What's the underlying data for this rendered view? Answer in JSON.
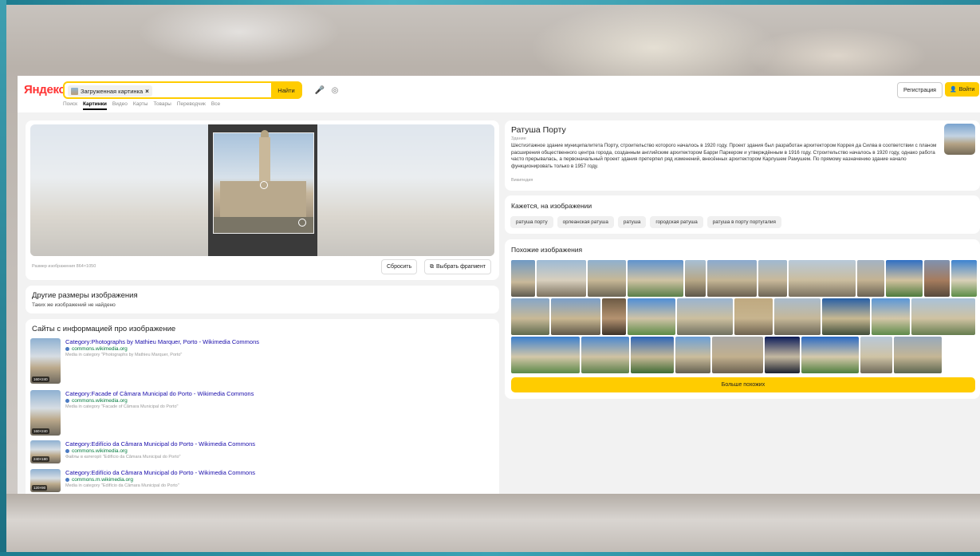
{
  "header": {
    "logo": "Яндекс",
    "search_chip_label": "Загруженная картинка",
    "search_chip_close": "×",
    "find_label": "Найти",
    "tabs": [
      "Поиск",
      "Картинки",
      "Видео",
      "Карты",
      "Товары",
      "Переводчик",
      "Все"
    ],
    "register_label": "Регистрация",
    "login_label": "Войти"
  },
  "preview": {
    "size_text": "Размер изображения 864×1050",
    "reset_label": "Сбросить",
    "crop_label": "Выбрать фрагмент"
  },
  "sizes": {
    "title": "Другие размеры изображения",
    "subtitle": "Таких же изображений не найдено"
  },
  "sites": {
    "title": "Сайты с информацией про изображение",
    "items": [
      {
        "title": "Category:Photographs by Mathieu Marquer, Porto - Wikimedia Commons",
        "domain": "commons.wikimedia.org",
        "desc": "Media in category \"Photographs by Mathieu Marquer, Porto\"",
        "badge": "160×240"
      },
      {
        "title": "Category:Facade of Câmara Municipal do Porto - Wikimedia Commons",
        "domain": "commons.wikimedia.org",
        "desc": "Media in category \"Facade of Câmara Municipal do Porto\"",
        "badge": "160×240"
      },
      {
        "title": "Category:Edifício da Câmara Municipal do Porto - Wikimedia Commons",
        "domain": "commons.wikimedia.org",
        "desc": "Файлы в категорії \"Edifício da Câmara Municipal do Porto\"",
        "badge": "240×180"
      },
      {
        "title": "Category:Edifício da Câmara Municipal do Porto - Wikimedia Commons",
        "domain": "commons.m.wikimedia.org",
        "desc": "Media in category \"Edifício da Câmara Municipal do Porto\"",
        "badge": "120×90"
      }
    ]
  },
  "info": {
    "title": "Ратуша Порту",
    "kind": "Здание",
    "description": "Шестиэтажное здание муниципалитета Порту, строительство которого началось в 1920 году. Проект здания был разработан архитектором Коррея да Силва в соответствии с планом расширения общественного центра города, созданным английским архитектором Барри Паркером и утверждённым в 1916 году. Строительство началось в 1920 году, однако работа часто прерывалась, а первоначальный проект здания претерпел ряд изменений, внесённых архитектором Карлушем Рамушем. По прямому назначению здание начало функционировать только в 1957 году.",
    "source": "Википедия"
  },
  "tags": {
    "title": "Кажется, на изображении",
    "items": [
      "ратуша порту",
      "орлеанская ратуша",
      "ратуша",
      "городская ратуша",
      "ратуша в порту португалия"
    ]
  },
  "similar": {
    "title": "Похожие изображения",
    "more_label": "Больше похожих"
  },
  "colors": {
    "accent": "#ffcc00",
    "link": "#1a0dab",
    "domain": "#007a3d",
    "logo_red": "#ff3333"
  }
}
